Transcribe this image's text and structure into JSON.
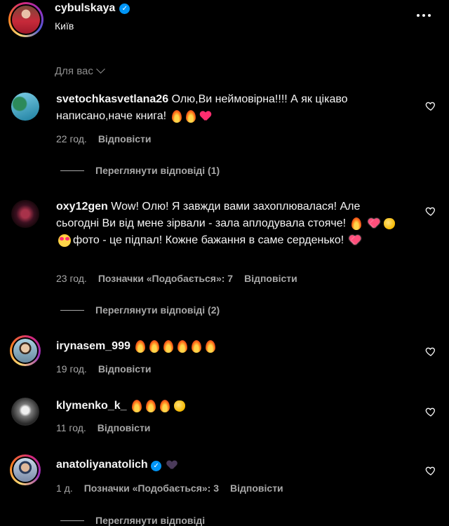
{
  "header": {
    "username": "cybulskaya",
    "location": "Київ"
  },
  "filter": {
    "label": "Для вас"
  },
  "comments": [
    {
      "username": "svetochkasvetlana26",
      "text": "Олю,Ви неймовірна!!!! А як цікаво написано,наче книга!",
      "time": "22 год.",
      "reply": "Відповісти",
      "view_replies": "Переглянути відповіді (1)"
    },
    {
      "username": "oxy12gen",
      "text1": "Wow! Олю! Я завжди вами захоплювалася! Але сьогодні Ви від мене зірвали - зала аплодувала стояче!",
      "text2": "фото - це підпал! Кожне бажання в саме серденько!",
      "time": "23 год.",
      "likes": "Позначки «Подобається»: 7",
      "reply": "Відповісти",
      "view_replies": "Переглянути відповіді (2)"
    },
    {
      "username": "irynasem_999",
      "time": "19 год.",
      "reply": "Відповісти"
    },
    {
      "username": "klymenko_k_",
      "time": "11 год.",
      "reply": "Відповісти"
    },
    {
      "username": "anatoliyanatolich",
      "time": "1 д.",
      "likes": "Позначки «Подобається»: 3",
      "reply": "Відповісти",
      "view_replies": "Переглянути відповіді"
    }
  ]
}
